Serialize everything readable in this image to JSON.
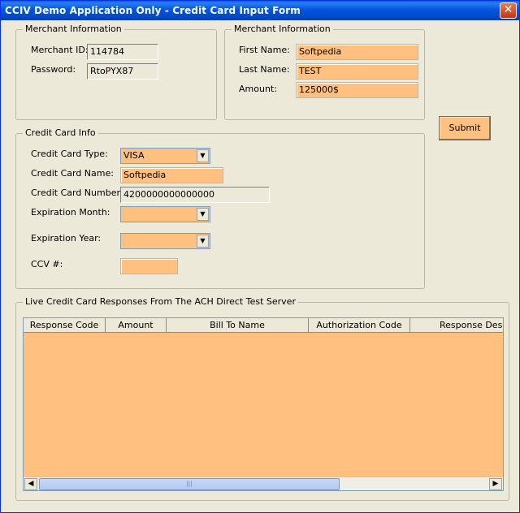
{
  "window": {
    "title": "CCIV Demo Application  Only - Credit Card Input Form",
    "close_glyph": "✕"
  },
  "merchant_left": {
    "title": "Merchant Information",
    "merchant_id_label": "Merchant ID:",
    "merchant_id_value": "114784",
    "password_label": "Password:",
    "password_value": "RtoPYX87"
  },
  "merchant_right": {
    "title": "Merchant Information",
    "first_name_label": "First Name:",
    "first_name_value": "Softpedia",
    "last_name_label": "Last Name:",
    "last_name_value": "TEST",
    "amount_label": "Amount:",
    "amount_value": "125000$"
  },
  "submit_label": "Submit",
  "card": {
    "title": "Credit Card Info",
    "type_label": "Credit Card Type:",
    "type_value": "VISA",
    "name_label": "Credit Card Name:",
    "name_value": "Softpedia",
    "number_label": "Credit Card Number:",
    "number_value": "4200000000000000",
    "exp_month_label": "Expiration Month:",
    "exp_month_value": "",
    "exp_year_label": "Expiration Year:",
    "exp_year_value": "",
    "ccv_label": "CCV #:",
    "ccv_value": ""
  },
  "responses": {
    "title": "Live Credit Card Responses From The ACH Direct Test Server",
    "columns": [
      "Response Code",
      "Amount",
      "Bill To Name",
      "Authorization Code",
      "Response Descr"
    ],
    "rows": [],
    "scroll_left": "◀",
    "scroll_right": "▶",
    "thumb_grip": "|||"
  },
  "colors": {
    "input_orange": "#ffc080",
    "window_bg": "#ece9d8",
    "titlebar_blue": "#0054e3"
  }
}
